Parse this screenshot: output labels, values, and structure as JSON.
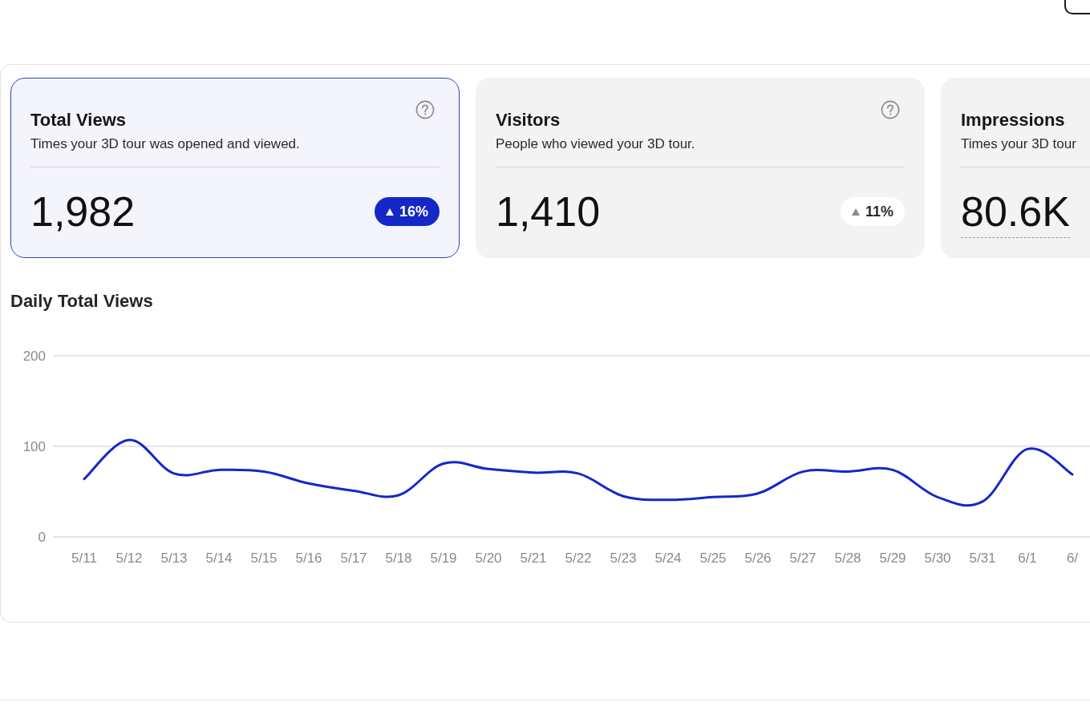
{
  "cards": [
    {
      "title": "Total Views",
      "description": "Times your 3D tour was opened and viewed.",
      "value": "1,982",
      "change": "16%",
      "rising": true,
      "selected": true,
      "value_underlined": false
    },
    {
      "title": "Visitors",
      "description": "People who viewed your 3D tour.",
      "value": "1,410",
      "change": "11%",
      "rising": true,
      "selected": false,
      "value_underlined": false
    },
    {
      "title": "Impressions",
      "description": "Times your 3D tour",
      "value": "80.6K",
      "selected": false,
      "value_underlined": true
    }
  ],
  "chart": {
    "chart_data": {
      "type": "line",
      "title": "Daily Total Views",
      "categories": [
        "5/11",
        "5/12",
        "5/13",
        "5/14",
        "5/15",
        "5/16",
        "5/17",
        "5/18",
        "5/19",
        "5/20",
        "5/21",
        "5/22",
        "5/23",
        "5/24",
        "5/25",
        "5/26",
        "5/27",
        "5/28",
        "5/29",
        "5/30",
        "5/31",
        "6/1",
        "6/"
      ],
      "series": [
        {
          "color": "#1428c8",
          "values": [
            64,
            107,
            70,
            74,
            72,
            59,
            51,
            46,
            81,
            75,
            71,
            70,
            45,
            41,
            44,
            48,
            72,
            72,
            74,
            44,
            39,
            97,
            69
          ]
        }
      ],
      "ylim": [
        0,
        200
      ],
      "yticks": [
        0,
        100,
        200
      ]
    }
  }
}
